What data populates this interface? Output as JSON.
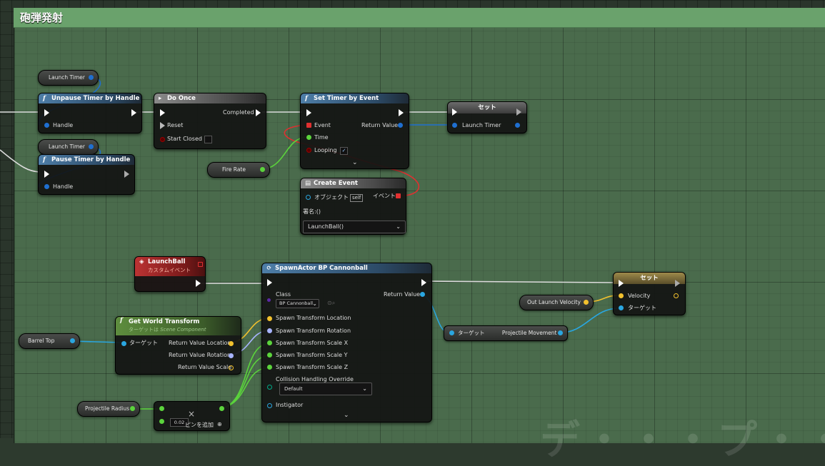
{
  "comment": {
    "title": "砲弾発射"
  },
  "vars": {
    "launch_timer_1": "Launch Timer",
    "launch_timer_2": "Launch Timer",
    "fire_rate": "Fire Rate",
    "barrel_top": "Barrel Top",
    "projectile_radius": "Projectile Radius",
    "out_launch_velocity": "Out Launch Velocity"
  },
  "nodes": {
    "unpause": {
      "title": "Unpause Timer by Handle",
      "handle": "Handle"
    },
    "pause": {
      "title": "Pause Timer by Handle",
      "handle": "Handle"
    },
    "do_once": {
      "title": "Do Once",
      "completed": "Completed",
      "reset": "Reset",
      "start_closed": "Start Closed"
    },
    "set_timer": {
      "title": "Set Timer by Event",
      "event": "Event",
      "time": "Time",
      "looping": "Looping",
      "return_value": "Return Value",
      "looping_checked": "✓"
    },
    "set_launch_timer": {
      "title": "セット",
      "launch_timer": "Launch Timer"
    },
    "create_event": {
      "title": "Create Event",
      "object": "オブジェクト",
      "self": "self",
      "event": "イベント",
      "signature": "署名:()",
      "selected": "LaunchBall()"
    },
    "launch_ball": {
      "title": "LaunchBall",
      "subtitle": "カスタムイベント"
    },
    "spawn": {
      "title": "SpawnActor BP Cannonball",
      "class": "Class",
      "class_value": "BP Cannonball",
      "return_value": "Return Value",
      "loc": "Spawn Transform Location",
      "rot": "Spawn Transform Rotation",
      "sx": "Spawn Transform Scale X",
      "sy": "Spawn Transform Scale Y",
      "sz": "Spawn Transform Scale Z",
      "collision": "Collision Handling Override",
      "collision_value": "Default",
      "instigator": "Instigator"
    },
    "get_world_transform": {
      "title": "Get World Transform",
      "subtitle_prefix": "ターゲットは",
      "subtitle_target": "Scene Component",
      "target": "ターゲット",
      "loc": "Return Value Location",
      "rot": "Return Value Rotation",
      "scale": "Return Value Scale"
    },
    "projectile_movement": {
      "target": "ターゲット",
      "label": "Projectile Movement"
    },
    "set_velocity": {
      "title": "セット",
      "velocity": "Velocity",
      "target": "ターゲット"
    },
    "multiply": {
      "value": "0.02",
      "add_pin": "ピンを追加",
      "x": "×"
    }
  },
  "watermark": "デ・・・プ・・・"
}
